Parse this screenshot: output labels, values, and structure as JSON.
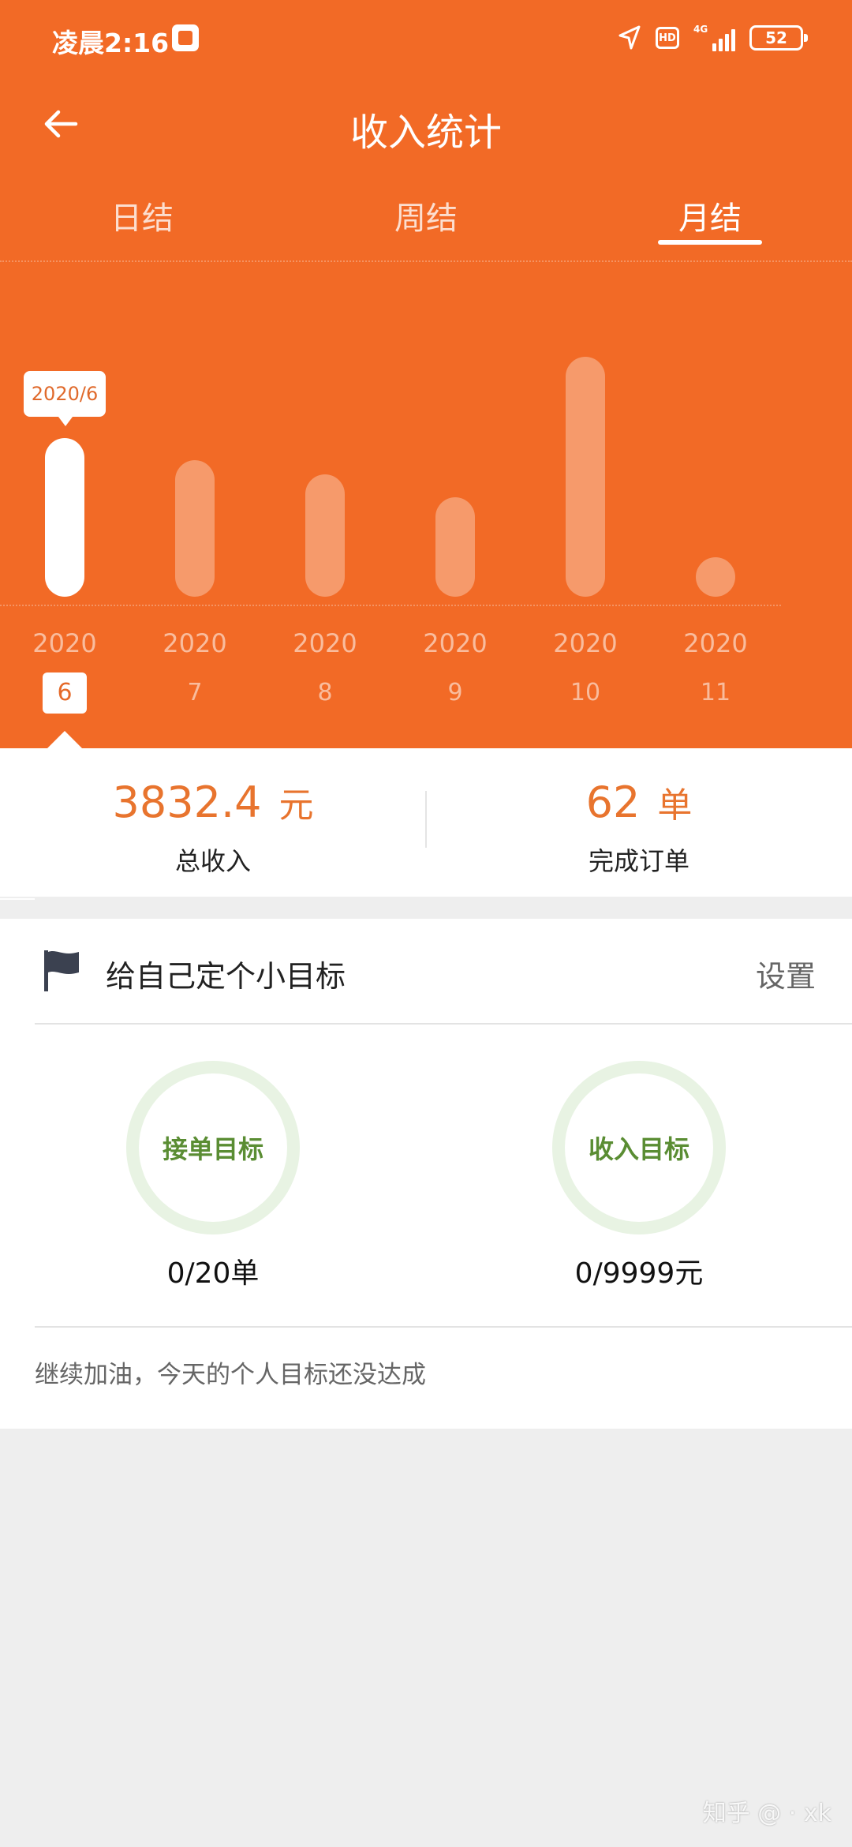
{
  "status_bar": {
    "time": "凌晨2:16",
    "hd": "HD",
    "network": "4G",
    "battery": "52"
  },
  "header": {
    "title": "收入统计"
  },
  "tabs": [
    {
      "label": "日结",
      "active": false
    },
    {
      "label": "周结",
      "active": false
    },
    {
      "label": "月结",
      "active": true
    }
  ],
  "chart_data": {
    "type": "bar",
    "categories": [
      "2020/6",
      "2020/7",
      "2020/8",
      "2020/9",
      "2020/10",
      "2020/11"
    ],
    "years": [
      "2020",
      "2020",
      "2020",
      "2020",
      "2020",
      "2020"
    ],
    "months": [
      "6",
      "7",
      "8",
      "9",
      "10",
      "11"
    ],
    "values": [
      3832.4,
      3300,
      2950,
      2400,
      5800,
      0
    ],
    "selected_index": 0,
    "tooltip": "2020/6",
    "xlabel": "",
    "ylabel": "",
    "legend": "none",
    "grid": false
  },
  "summary": {
    "income": {
      "value": "3832.4",
      "unit": "元",
      "label": "总收入"
    },
    "orders": {
      "value": "62",
      "unit": "单",
      "label": "完成订单"
    }
  },
  "goal": {
    "title": "给自己定个小目标",
    "settings": "设置",
    "order_goal": {
      "label": "接单目标",
      "value": "0/20单"
    },
    "income_goal": {
      "label": "收入目标",
      "value": "0/9999元"
    },
    "message": "继续加油，今天的个人目标还没达成"
  },
  "watermark": "知乎 @ · xk",
  "colors": {
    "accent": "#f26a26",
    "ring": "#e8f3e3",
    "ring_text": "#5a8d33"
  }
}
